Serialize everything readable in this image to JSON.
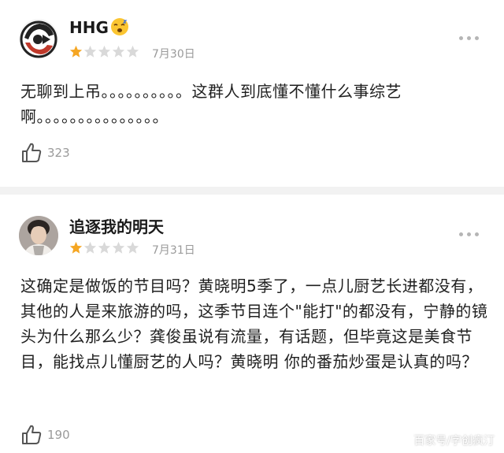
{
  "reviews": [
    {
      "username": "HHG",
      "has_emoji": true,
      "rating": 1,
      "max_rating": 5,
      "date": "7月30日",
      "content": "无聊到上吊。。。。。。。。。。这群人到底懂不懂什么事综艺啊。。。。。。。。。。。。。。。",
      "likes": "323"
    },
    {
      "username": "追逐我的明天",
      "has_emoji": false,
      "rating": 1,
      "max_rating": 5,
      "date": "7月31日",
      "content": "这确定是做饭的节目吗？黄晓明5季了，一点儿厨艺长进都没有，其他的人是来旅游的吗，这季节目连个\"能打\"的都没有，宁静的镜头为什么那么少？龚俊虽说有流量，有话题，但毕竟这是美食节目，能找点儿懂厨艺的人吗？黄晓明 你的番茄炒蛋是认真的吗？",
      "likes": "190"
    }
  ],
  "watermark": "百家号/字创疯汀",
  "colors": {
    "star_filled": "#f5a623",
    "star_empty": "#d9d9d9",
    "divider": "#f2f2f2"
  },
  "icons": [
    "more-dots-icon",
    "thumbs-up-icon",
    "star-icon",
    "sleepy-emoji-icon"
  ]
}
